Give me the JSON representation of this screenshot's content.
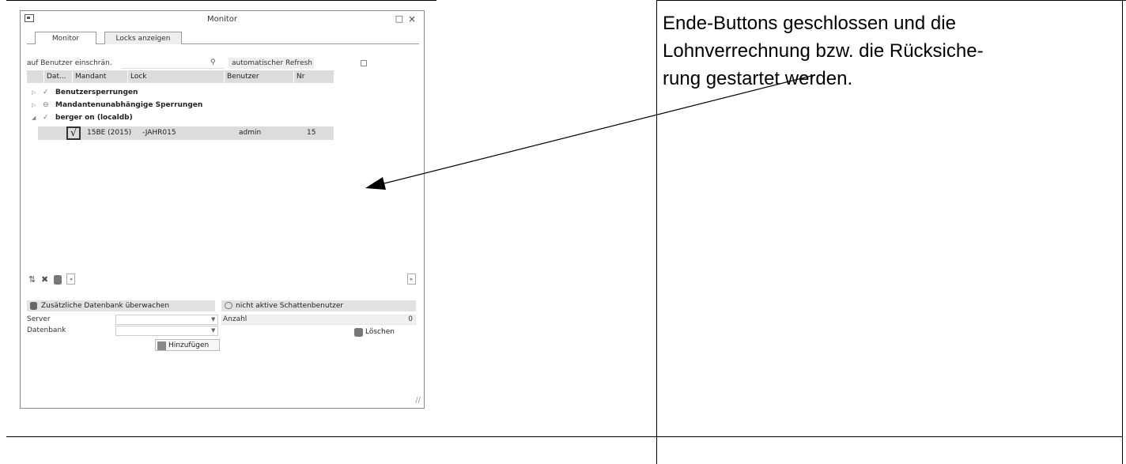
{
  "document": {
    "paragraph_lines": [
      "Ende-Buttons geschlossen und die",
      "Lohnverrechnung bzw. die Rücksiche-",
      "rung gestartet werden."
    ]
  },
  "window": {
    "title": "Monitor",
    "maximize_glyph": "□",
    "close_glyph": "×"
  },
  "tabs": [
    "Monitor",
    "Locks anzeigen"
  ],
  "filter": {
    "label": "auf Benutzer einschrän.",
    "search_glyph": "⚲",
    "refresh_label": "automatischer Refresh",
    "refresh_checked": false
  },
  "grid": {
    "columns": [
      "",
      "Dat...",
      "Mandant",
      "Lock",
      "Benutzer",
      "Nr"
    ],
    "groups": [
      {
        "expander": "▷",
        "icon": "✓",
        "label": "Benutzersperrungen"
      },
      {
        "expander": "▷",
        "icon": "⊖",
        "label": "Mandantenunabhängige Sperrungen"
      },
      {
        "expander": "◢",
        "icon": "✓",
        "label": "berger on (localdb)"
      }
    ],
    "row": {
      "checked_glyph": "√",
      "mandant": "15BE (2015)",
      "lock": "-JAHR015",
      "benutzer": "admin",
      "nr": "15"
    }
  },
  "toolbar": {
    "sort_glyph": "⇅",
    "delete_glyph": "✖",
    "scroll_left": "◂",
    "scroll_right": "▸"
  },
  "db_panel": {
    "title": "Zusätzliche Datenbank überwachen",
    "server_label": "Server",
    "database_label": "Datenbank",
    "dropdown_glyph": "▼",
    "add_button": "Hinzufügen"
  },
  "shadow_panel": {
    "title": "nicht aktive Schattenbenutzer",
    "count_label": "Anzahl",
    "count_value": "0",
    "delete_button": "Löschen"
  },
  "resize_grip": "//",
  "colors": {
    "header_gray": "#dcdcdc",
    "panel_gray": "#e2e2e2",
    "arrow": "#000000"
  }
}
